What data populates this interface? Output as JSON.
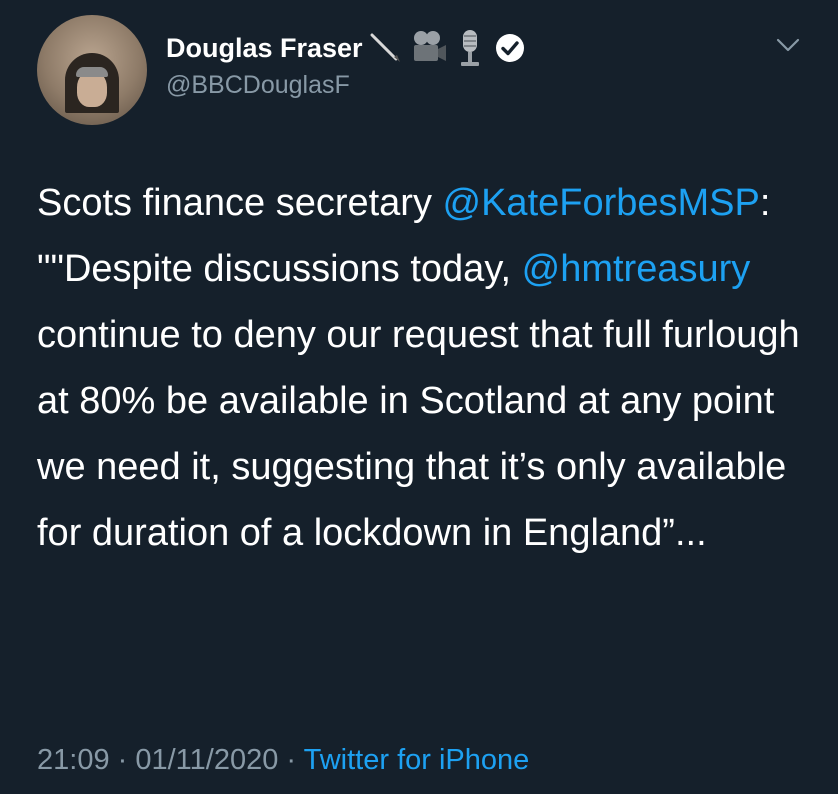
{
  "author": {
    "display_name": "Douglas Fraser",
    "handle": "@BBCDouglasF",
    "emoji_icons": [
      "pen-icon",
      "movie-camera-icon",
      "microphone-icon"
    ],
    "verified_icon": "verified-badge-icon"
  },
  "menu": {
    "icon": "chevron-down-icon"
  },
  "tweet": {
    "segments": [
      {
        "type": "text",
        "text": "Scots finance secretary "
      },
      {
        "type": "mention",
        "text": "@KateForbesMSP"
      },
      {
        "type": "text",
        "text": ": \"\"Despite discussions today, "
      },
      {
        "type": "mention",
        "text": "@hmtreasury"
      },
      {
        "type": "text",
        "text": " continue to deny our request that full furlough at 80% be available in Scotland at any point we need it, suggesting that it’s only available for duration of a lockdown in England”..."
      }
    ]
  },
  "meta": {
    "time": "21:09",
    "separator": " · ",
    "date": "01/11/2020",
    "source": "Twitter for iPhone"
  },
  "colors": {
    "background": "#15202b",
    "text": "#ffffff",
    "secondary": "#8899a6",
    "accent": "#1da1f2"
  }
}
